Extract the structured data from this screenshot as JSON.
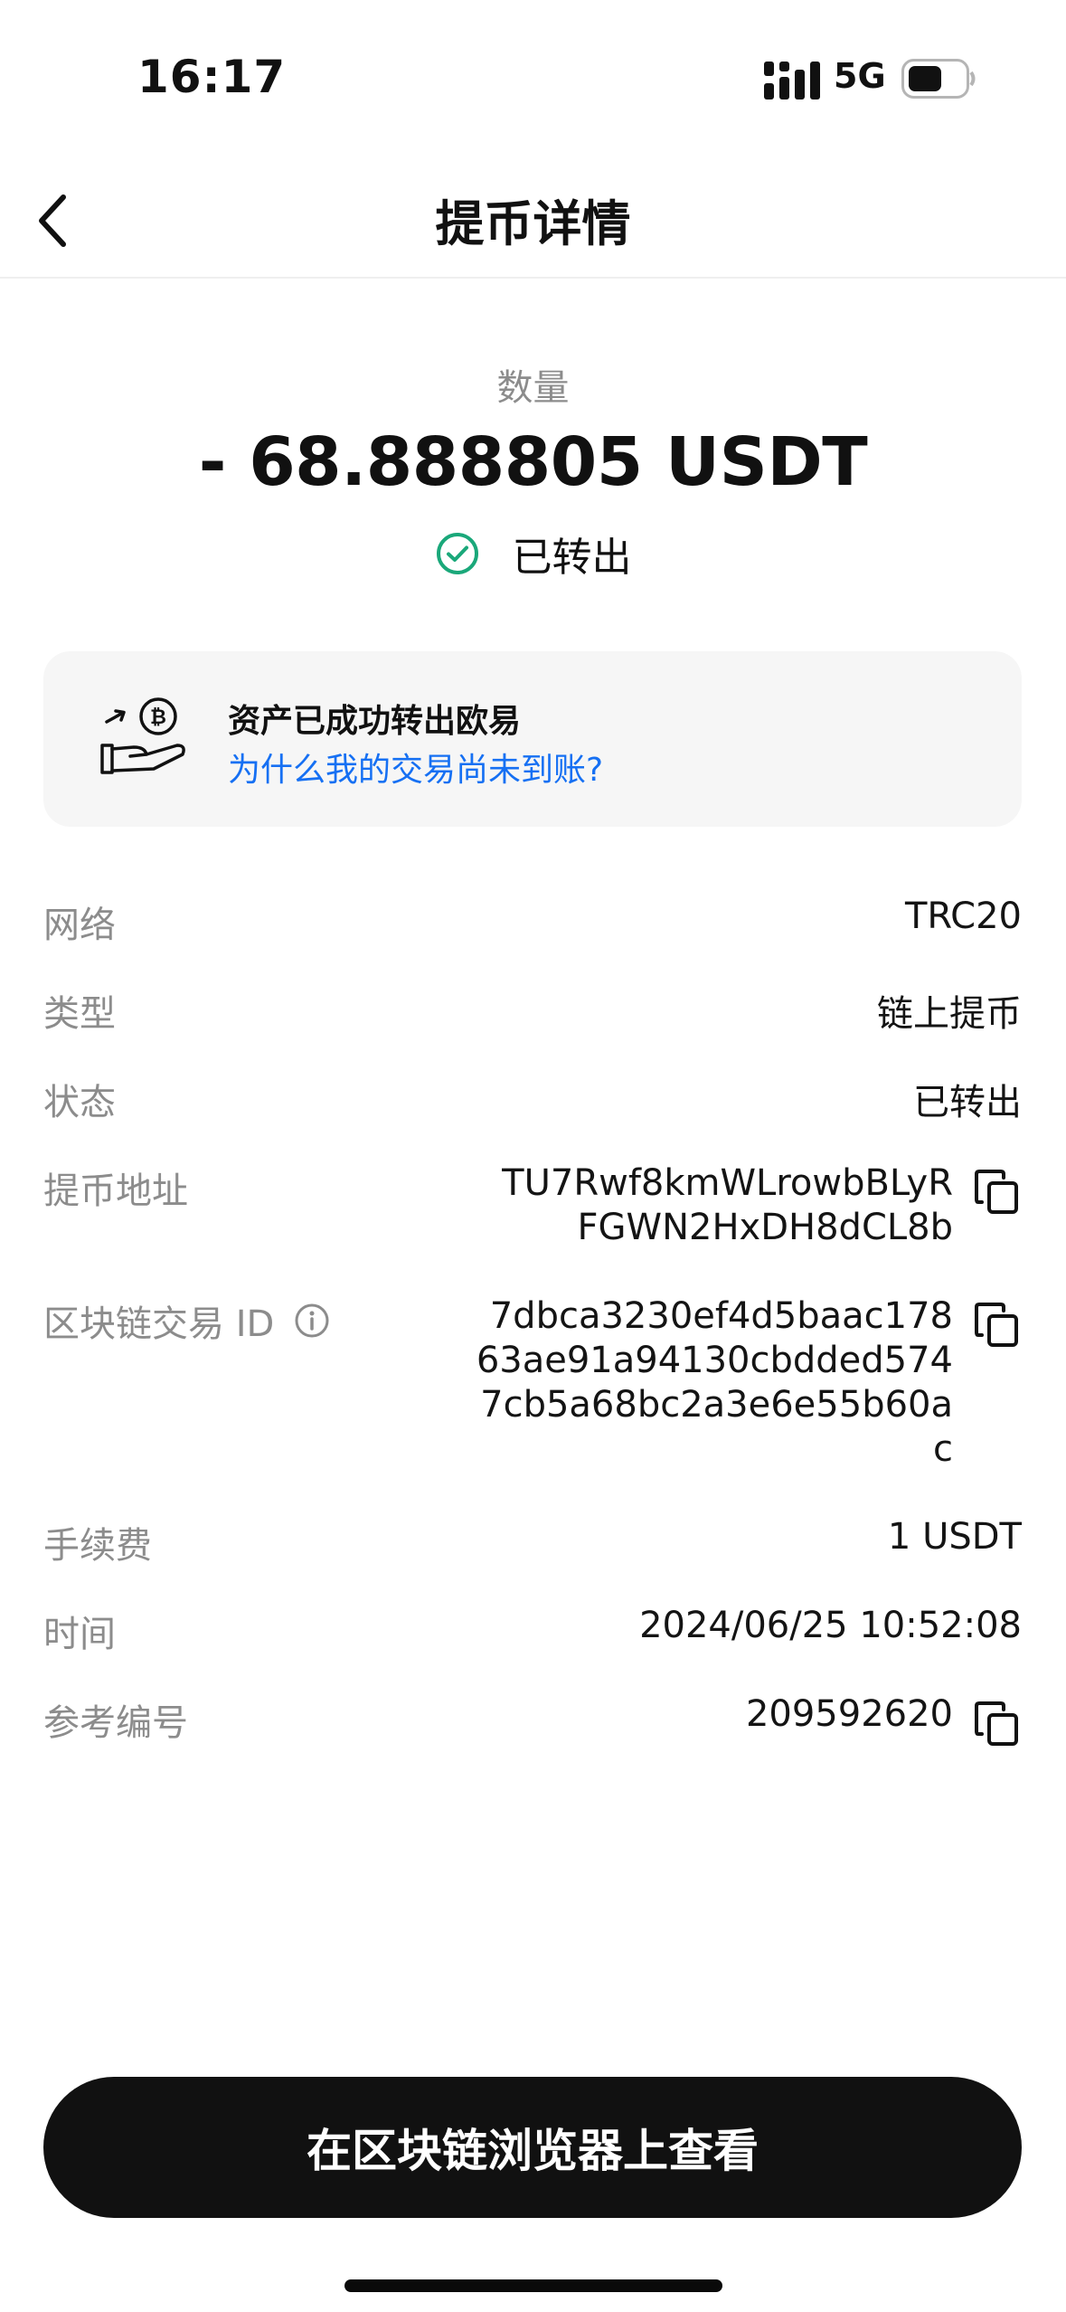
{
  "status_bar": {
    "time": "16:17",
    "network": "5G"
  },
  "nav": {
    "title": "提币详情"
  },
  "summary": {
    "quantity_label": "数量",
    "amount": "- 68.888805 USDT",
    "status": "已转出"
  },
  "notice": {
    "line1": "资产已成功转出欧易",
    "line2": "为什么我的交易尚未到账?"
  },
  "details": {
    "network_label": "网络",
    "network_value": "TRC20",
    "type_label": "类型",
    "type_value": "链上提币",
    "status_label": "状态",
    "status_value": "已转出",
    "address_label": "提币地址",
    "address_line1": "TU7Rwf8kmWLrowbBLyR",
    "address_line2": "FGWN2HxDH8dCL8b",
    "txid_label": "区块链交易 ID",
    "txid_line1": "7dbca3230ef4d5baac178",
    "txid_line2": "63ae91a94130cbdded574",
    "txid_line3": "7cb5a68bc2a3e6e55b60a",
    "txid_line4": "c",
    "fee_label": "手续费",
    "fee_value": "1 USDT",
    "time_label": "时间",
    "time_value": "2024/06/25 10:52:08",
    "ref_label": "参考编号",
    "ref_value": "209592620"
  },
  "actions": {
    "view_button": "在区块链浏览器上查看"
  },
  "colors": {
    "success": "#1aa87a",
    "link": "#1670f3",
    "button_bg": "#111111",
    "muted_text": "#8c8c8c"
  },
  "icons": [
    "signal-icon",
    "battery-icon",
    "back-chevron-icon",
    "check-circle-icon",
    "hand-coin-icon",
    "info-icon",
    "copy-icon"
  ]
}
